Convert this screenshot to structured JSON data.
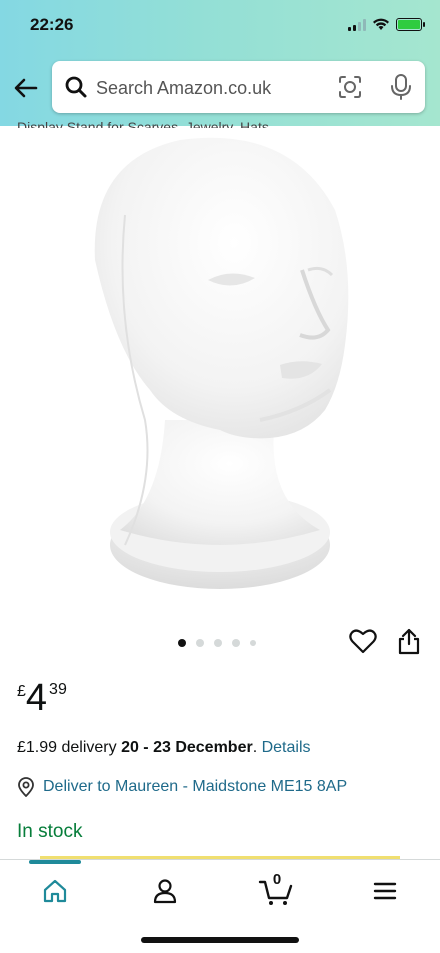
{
  "status_bar": {
    "time": "22:26"
  },
  "search": {
    "placeholder": "Search Amazon.co.uk"
  },
  "product": {
    "clipped_title": "Display Stand for Scarves, Jewelry, Hats",
    "image_alt": "Foam mannequin head",
    "carousel": {
      "total": 5,
      "active_index": 0
    }
  },
  "price": {
    "symbol": "£",
    "whole": "4",
    "fraction": "39"
  },
  "delivery": {
    "prefix": "£1.99 delivery ",
    "dates": "20 - 23 December",
    "separator": ". ",
    "details_link": "Details"
  },
  "location": {
    "text": "Deliver to Maureen - Maidstone ME15 8AP"
  },
  "stock": {
    "text": "In stock"
  },
  "tab_bar": {
    "cart_count": "0",
    "active": "home"
  },
  "colors": {
    "link": "#1f6a8a",
    "in_stock": "#067d3a",
    "header_start": "#84d8e3",
    "header_end": "#a5e6cf"
  }
}
